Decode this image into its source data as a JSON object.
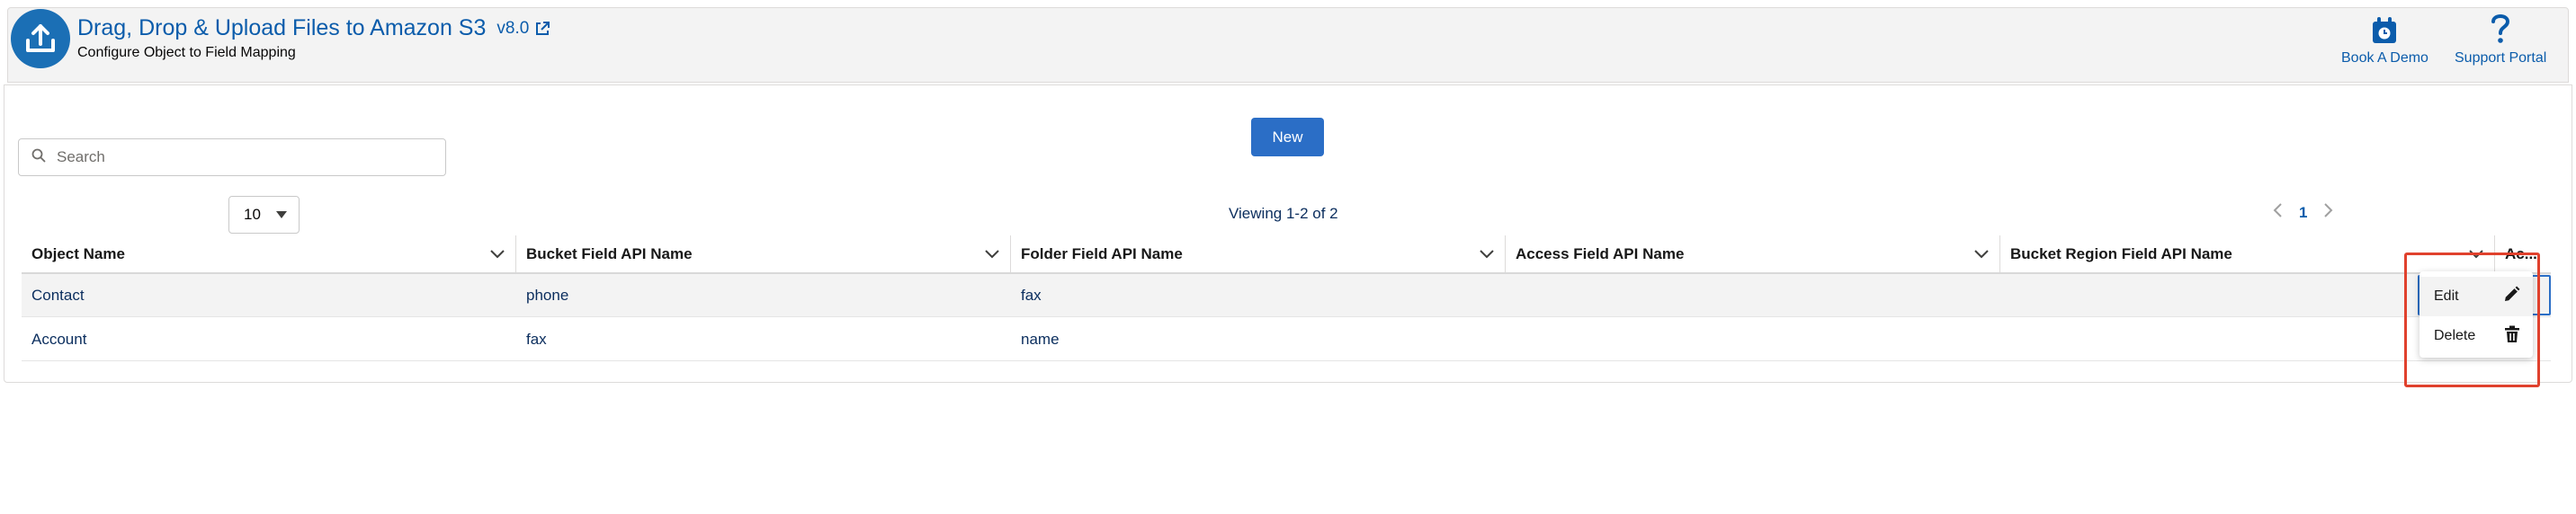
{
  "header": {
    "title": "Drag, Drop & Upload Files to Amazon S3",
    "version": "v8.0",
    "subtitle": "Configure Object to Field Mapping",
    "links": [
      {
        "label": "Book A Demo",
        "icon": "calendar-icon"
      },
      {
        "label": "Support Portal",
        "icon": "question-icon"
      }
    ],
    "accent_color": "#0b5cab",
    "icon_bg_color": "#1b6fb5"
  },
  "toolbar": {
    "new_label": "New",
    "search_placeholder": "Search",
    "search_value": "",
    "page_size": "10",
    "viewing_text": "Viewing 1-2 of 2",
    "current_page": "1"
  },
  "table": {
    "columns": [
      "Object Name",
      "Bucket Field API Name",
      "Folder Field API Name",
      "Access Field API Name",
      "Bucket Region Field API Name",
      "Ac..."
    ],
    "rows": [
      [
        "Contact",
        "phone",
        "fax",
        "",
        ""
      ],
      [
        "Account",
        "fax",
        "name",
        "",
        ""
      ]
    ]
  },
  "row_menu": {
    "items": [
      {
        "label": "Edit",
        "icon": "pencil-icon"
      },
      {
        "label": "Delete",
        "icon": "trash-icon"
      }
    ],
    "annotation_color": "#e0412d"
  }
}
